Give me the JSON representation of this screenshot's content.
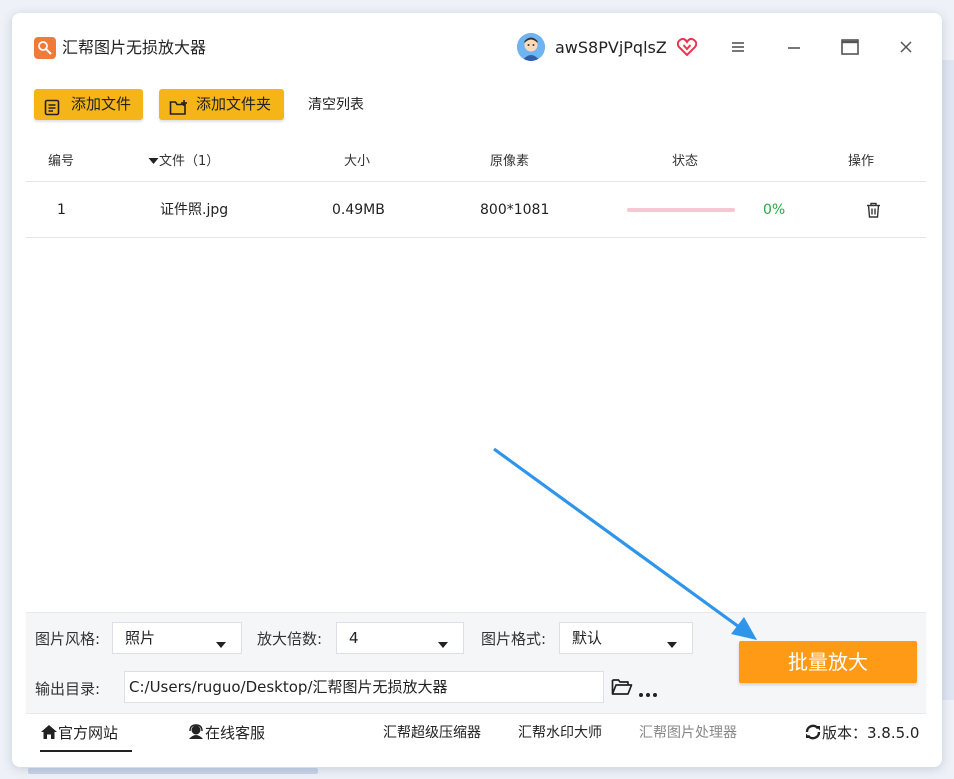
{
  "app": {
    "title": "汇帮图片无损放大器",
    "username": "awS8PVjPqlsZ",
    "accent_color": "#f5b519",
    "primary_button_color": "#ff9a16"
  },
  "toolbar": {
    "add_file_label": "添加文件",
    "add_folder_label": "添加文件夹",
    "clear_list_label": "清空列表"
  },
  "table": {
    "headers": [
      "编号",
      "文件（1）",
      "大小",
      "原像素",
      "状态",
      "操作"
    ],
    "rows": [
      {
        "index": "1",
        "filename": "证件照.jpg",
        "size": "0.49MB",
        "pixels": "800*1081",
        "progress": 0,
        "progress_text": "0%"
      }
    ]
  },
  "settings": {
    "style_label": "图片风格:",
    "style_value": "照片",
    "scale_label": "放大倍数:",
    "scale_value": "4",
    "format_label": "图片格式:",
    "format_value": "默认",
    "output_label": "输出目录:",
    "output_path": "C:/Users/ruguo/Desktop/汇帮图片无损放大器",
    "batch_button": "批量放大"
  },
  "footer": {
    "website": "官方网站",
    "service": "在线客服",
    "link1": "汇帮超级压缩器",
    "link2": "汇帮水印大师",
    "link3": "汇帮图片处理器",
    "version": "版本：3.8.5.0"
  },
  "icons": [
    "app-logo-icon",
    "avatar",
    "vip-heart-icon",
    "menu-icon",
    "minimize-icon",
    "maximize-icon",
    "close-icon",
    "add-file-icon",
    "add-folder-icon",
    "sort-caret-icon",
    "trash-icon",
    "chevron-down-icon",
    "folder-icon",
    "more-icon",
    "home-icon",
    "headset-icon",
    "refresh-icon"
  ]
}
